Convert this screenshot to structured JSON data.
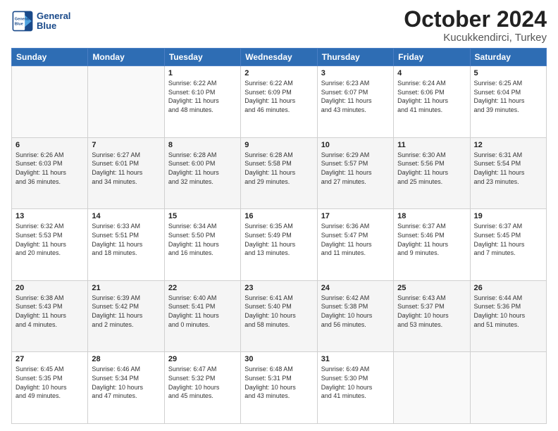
{
  "header": {
    "logo": {
      "line1": "General",
      "line2": "Blue"
    },
    "month": "October 2024",
    "location": "Kucukkendirci, Turkey"
  },
  "weekdays": [
    "Sunday",
    "Monday",
    "Tuesday",
    "Wednesday",
    "Thursday",
    "Friday",
    "Saturday"
  ],
  "weeks": [
    [
      {
        "day": "",
        "info": ""
      },
      {
        "day": "",
        "info": ""
      },
      {
        "day": "1",
        "info": "Sunrise: 6:22 AM\nSunset: 6:10 PM\nDaylight: 11 hours\nand 48 minutes."
      },
      {
        "day": "2",
        "info": "Sunrise: 6:22 AM\nSunset: 6:09 PM\nDaylight: 11 hours\nand 46 minutes."
      },
      {
        "day": "3",
        "info": "Sunrise: 6:23 AM\nSunset: 6:07 PM\nDaylight: 11 hours\nand 43 minutes."
      },
      {
        "day": "4",
        "info": "Sunrise: 6:24 AM\nSunset: 6:06 PM\nDaylight: 11 hours\nand 41 minutes."
      },
      {
        "day": "5",
        "info": "Sunrise: 6:25 AM\nSunset: 6:04 PM\nDaylight: 11 hours\nand 39 minutes."
      }
    ],
    [
      {
        "day": "6",
        "info": "Sunrise: 6:26 AM\nSunset: 6:03 PM\nDaylight: 11 hours\nand 36 minutes."
      },
      {
        "day": "7",
        "info": "Sunrise: 6:27 AM\nSunset: 6:01 PM\nDaylight: 11 hours\nand 34 minutes."
      },
      {
        "day": "8",
        "info": "Sunrise: 6:28 AM\nSunset: 6:00 PM\nDaylight: 11 hours\nand 32 minutes."
      },
      {
        "day": "9",
        "info": "Sunrise: 6:28 AM\nSunset: 5:58 PM\nDaylight: 11 hours\nand 29 minutes."
      },
      {
        "day": "10",
        "info": "Sunrise: 6:29 AM\nSunset: 5:57 PM\nDaylight: 11 hours\nand 27 minutes."
      },
      {
        "day": "11",
        "info": "Sunrise: 6:30 AM\nSunset: 5:56 PM\nDaylight: 11 hours\nand 25 minutes."
      },
      {
        "day": "12",
        "info": "Sunrise: 6:31 AM\nSunset: 5:54 PM\nDaylight: 11 hours\nand 23 minutes."
      }
    ],
    [
      {
        "day": "13",
        "info": "Sunrise: 6:32 AM\nSunset: 5:53 PM\nDaylight: 11 hours\nand 20 minutes."
      },
      {
        "day": "14",
        "info": "Sunrise: 6:33 AM\nSunset: 5:51 PM\nDaylight: 11 hours\nand 18 minutes."
      },
      {
        "day": "15",
        "info": "Sunrise: 6:34 AM\nSunset: 5:50 PM\nDaylight: 11 hours\nand 16 minutes."
      },
      {
        "day": "16",
        "info": "Sunrise: 6:35 AM\nSunset: 5:49 PM\nDaylight: 11 hours\nand 13 minutes."
      },
      {
        "day": "17",
        "info": "Sunrise: 6:36 AM\nSunset: 5:47 PM\nDaylight: 11 hours\nand 11 minutes."
      },
      {
        "day": "18",
        "info": "Sunrise: 6:37 AM\nSunset: 5:46 PM\nDaylight: 11 hours\nand 9 minutes."
      },
      {
        "day": "19",
        "info": "Sunrise: 6:37 AM\nSunset: 5:45 PM\nDaylight: 11 hours\nand 7 minutes."
      }
    ],
    [
      {
        "day": "20",
        "info": "Sunrise: 6:38 AM\nSunset: 5:43 PM\nDaylight: 11 hours\nand 4 minutes."
      },
      {
        "day": "21",
        "info": "Sunrise: 6:39 AM\nSunset: 5:42 PM\nDaylight: 11 hours\nand 2 minutes."
      },
      {
        "day": "22",
        "info": "Sunrise: 6:40 AM\nSunset: 5:41 PM\nDaylight: 11 hours\nand 0 minutes."
      },
      {
        "day": "23",
        "info": "Sunrise: 6:41 AM\nSunset: 5:40 PM\nDaylight: 10 hours\nand 58 minutes."
      },
      {
        "day": "24",
        "info": "Sunrise: 6:42 AM\nSunset: 5:38 PM\nDaylight: 10 hours\nand 56 minutes."
      },
      {
        "day": "25",
        "info": "Sunrise: 6:43 AM\nSunset: 5:37 PM\nDaylight: 10 hours\nand 53 minutes."
      },
      {
        "day": "26",
        "info": "Sunrise: 6:44 AM\nSunset: 5:36 PM\nDaylight: 10 hours\nand 51 minutes."
      }
    ],
    [
      {
        "day": "27",
        "info": "Sunrise: 6:45 AM\nSunset: 5:35 PM\nDaylight: 10 hours\nand 49 minutes."
      },
      {
        "day": "28",
        "info": "Sunrise: 6:46 AM\nSunset: 5:34 PM\nDaylight: 10 hours\nand 47 minutes."
      },
      {
        "day": "29",
        "info": "Sunrise: 6:47 AM\nSunset: 5:32 PM\nDaylight: 10 hours\nand 45 minutes."
      },
      {
        "day": "30",
        "info": "Sunrise: 6:48 AM\nSunset: 5:31 PM\nDaylight: 10 hours\nand 43 minutes."
      },
      {
        "day": "31",
        "info": "Sunrise: 6:49 AM\nSunset: 5:30 PM\nDaylight: 10 hours\nand 41 minutes."
      },
      {
        "day": "",
        "info": ""
      },
      {
        "day": "",
        "info": ""
      }
    ]
  ]
}
